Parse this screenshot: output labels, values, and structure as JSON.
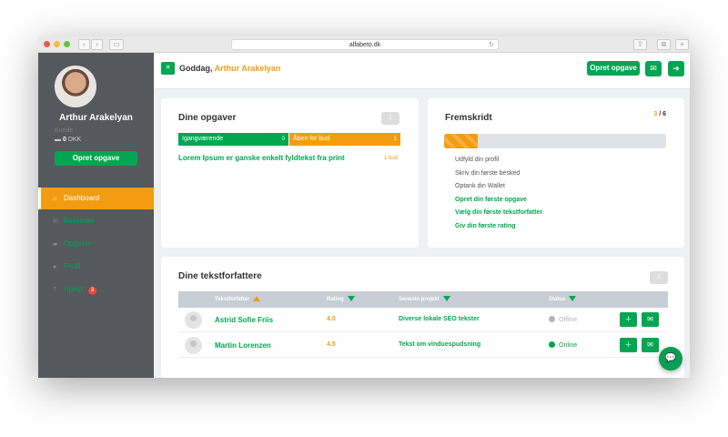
{
  "browser": {
    "url": "alfabeto.dk"
  },
  "profile": {
    "name": "Arthur Arakelyan",
    "role": "Kunde",
    "balance_value": "0",
    "balance_currency": "DKK",
    "cta": "Opret opgave"
  },
  "nav": [
    {
      "label": "Dashboard",
      "active": true
    },
    {
      "label": "Beskeder"
    },
    {
      "label": "Opgaver"
    },
    {
      "label": "Profil"
    },
    {
      "label": "Hjælp",
      "badge": "3"
    }
  ],
  "topbar": {
    "greeting": "Goddag,",
    "name": "Arthur Arakelyan",
    "cta": "Opret opgave"
  },
  "tasks": {
    "title": "Dine opgaver",
    "count": "1",
    "tabs": [
      {
        "label": "Igangværende",
        "count": "0"
      },
      {
        "label": "Åben for bud",
        "count": "1"
      }
    ],
    "item": {
      "title": "Lorem Ipsum er ganske enkelt fyldtekst fra print",
      "bids": "1 bud"
    }
  },
  "progress": {
    "title": "Fremskridt",
    "done": "3",
    "sep": "/",
    "total": "6",
    "fraction": 0.15,
    "steps": [
      {
        "label": "Udfyld din profil",
        "done": true
      },
      {
        "label": "Skriv din første besked",
        "done": true
      },
      {
        "label": "Optank din Wallet",
        "done": true
      },
      {
        "label": "Opret din første opgave",
        "done": false
      },
      {
        "label": "Vælg din første tekstforfatter",
        "done": false
      },
      {
        "label": "Giv din første rating",
        "done": false
      }
    ]
  },
  "writers": {
    "title": "Dine tekstforfattere",
    "count": "2",
    "columns": {
      "writer": "Tekstforfatter",
      "rating": "Rating",
      "project": "Seneste projekt",
      "status": "Status"
    },
    "rows": [
      {
        "name": "Astrid Sofie Friis",
        "rating": "4.0",
        "project": "Diverse lokale SEO tekster",
        "status": "Offline",
        "status_color": "#b5b5b5"
      },
      {
        "name": "Martin Lorenzen",
        "rating": "4.5",
        "project": "Tekst om vinduespudsning",
        "status": "Online",
        "status_color": "#00a651"
      }
    ]
  },
  "colors": {
    "brand_green": "#00a651",
    "brand_orange": "#f39c12",
    "sidebar": "#55585c"
  }
}
